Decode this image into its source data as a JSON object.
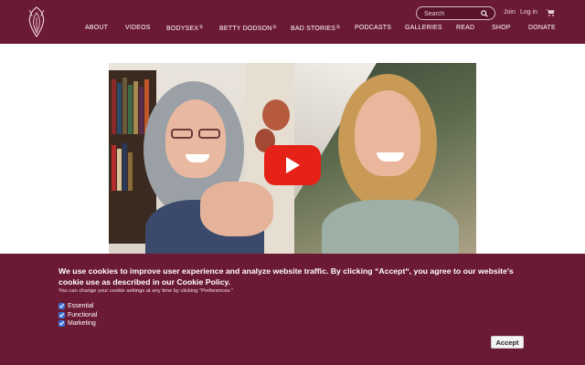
{
  "header": {
    "logo_icon": "ornamental-flower-logo",
    "search": {
      "placeholder": "Search",
      "icon": "search-icon"
    },
    "join_label": "Join",
    "login_label": "Log in",
    "cart_icon": "cart-icon",
    "nav": [
      {
        "label": "ABOUT",
        "external": false
      },
      {
        "label": "VIDEOS",
        "external": false
      },
      {
        "label": "BODYSEX",
        "external": true
      },
      {
        "label": "BETTY DODSON",
        "external": true
      },
      {
        "label": "BAD STORIES",
        "external": true
      },
      {
        "label": "PODCASTS",
        "external": false
      },
      {
        "label": "GALLERIES",
        "external": false
      },
      {
        "label": "READ",
        "external": false
      },
      {
        "label": "SHOP",
        "external": false
      },
      {
        "label": "DONATE",
        "external": false
      }
    ],
    "external_glyph": "⧉"
  },
  "video": {
    "play_icon": "youtube-play-icon"
  },
  "cookie_banner": {
    "message": "We use cookies to improve user experience and analyze website traffic. By clicking “Accept“, you agree to our website's cookie use as described in our Cookie Policy.",
    "sub": "You can change your cookie settings at any time by clicking “Preferences.”",
    "options": [
      {
        "label": "Essential",
        "checked": true
      },
      {
        "label": "Functional",
        "checked": true
      },
      {
        "label": "Marketing",
        "checked": true
      }
    ],
    "accept_label": "Accept"
  },
  "colors": {
    "brand": "#6b1a33",
    "play": "#e62117"
  }
}
